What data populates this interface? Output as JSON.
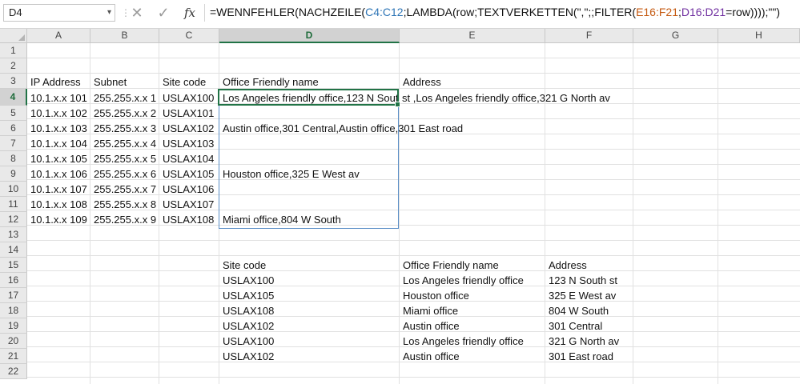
{
  "formula_bar": {
    "name_box": "D4",
    "cancel_icon": "close-icon",
    "enter_icon": "check-icon",
    "fx_label": "fx",
    "formula_parts": [
      "=WENNFEHLER(NACHZEILE(",
      "C4:C12",
      ";LAMBDA(row;TEXTVERKETTEN(\",\";;FILTER(",
      "E16:F21",
      ";",
      "D16:D21",
      "=row))));\"\")"
    ]
  },
  "columns": [
    "A",
    "B",
    "C",
    "D",
    "E",
    "F",
    "G",
    "H"
  ],
  "rows": [
    "1",
    "2",
    "3",
    "4",
    "5",
    "6",
    "7",
    "8",
    "9",
    "10",
    "11",
    "12",
    "13",
    "14",
    "15",
    "16",
    "17",
    "18",
    "19",
    "20",
    "21",
    "22"
  ],
  "header_row3": {
    "a": "IP Address",
    "b": "Subnet",
    "c": "Site code",
    "d": "Office Friendly name",
    "e": "Address"
  },
  "table1": [
    {
      "ip": "10.1.x.x 101",
      "subnet": "255.255.x.x 1",
      "site": "USLAX100"
    },
    {
      "ip": "10.1.x.x 102",
      "subnet": "255.255.x.x 2",
      "site": "USLAX101"
    },
    {
      "ip": "10.1.x.x 103",
      "subnet": "255.255.x.x 3",
      "site": "USLAX102"
    },
    {
      "ip": "10.1.x.x 104",
      "subnet": "255.255.x.x 4",
      "site": "USLAX103"
    },
    {
      "ip": "10.1.x.x 105",
      "subnet": "255.255.x.x 5",
      "site": "USLAX104"
    },
    {
      "ip": "10.1.x.x 106",
      "subnet": "255.255.x.x 6",
      "site": "USLAX105"
    },
    {
      "ip": "10.1.x.x 107",
      "subnet": "255.255.x.x 7",
      "site": "USLAX106"
    },
    {
      "ip": "10.1.x.x 108",
      "subnet": "255.255.x.x 8",
      "site": "USLAX107"
    },
    {
      "ip": "10.1.x.x 109",
      "subnet": "255.255.x.x 9",
      "site": "USLAX108"
    }
  ],
  "spill_results": {
    "r4_d": "Los Angeles friendly office,123 N South",
    "r4_e": " st ,Los Angeles friendly office,321 G North av",
    "r6": "Austin office,301 Central,Austin office,301 East road",
    "r9": "Houston office,325 E West av",
    "r12": "Miami office,804 W South"
  },
  "lookup_header": {
    "site": "Site code",
    "name": "Office Friendly name",
    "address": "Address"
  },
  "lookup": [
    {
      "site": "USLAX100",
      "name": "Los Angeles friendly office",
      "address": "123 N South st"
    },
    {
      "site": "USLAX105",
      "name": "Houston office",
      "address": "325 E West av"
    },
    {
      "site": "USLAX108",
      "name": "Miami office",
      "address": "804 W South"
    },
    {
      "site": "USLAX102",
      "name": "Austin office",
      "address": "301 Central"
    },
    {
      "site": "USLAX100",
      "name": "Los Angeles friendly office",
      "address": "321 G North av"
    },
    {
      "site": "USLAX102",
      "name": "Austin office",
      "address": "301 East road"
    }
  ],
  "colors": {
    "active_cell_border": "#217346",
    "spill_border": "#5b8fc7",
    "ref_blue": "#2e75b6",
    "ref_orange": "#c55a11",
    "ref_purple": "#7030a0"
  }
}
